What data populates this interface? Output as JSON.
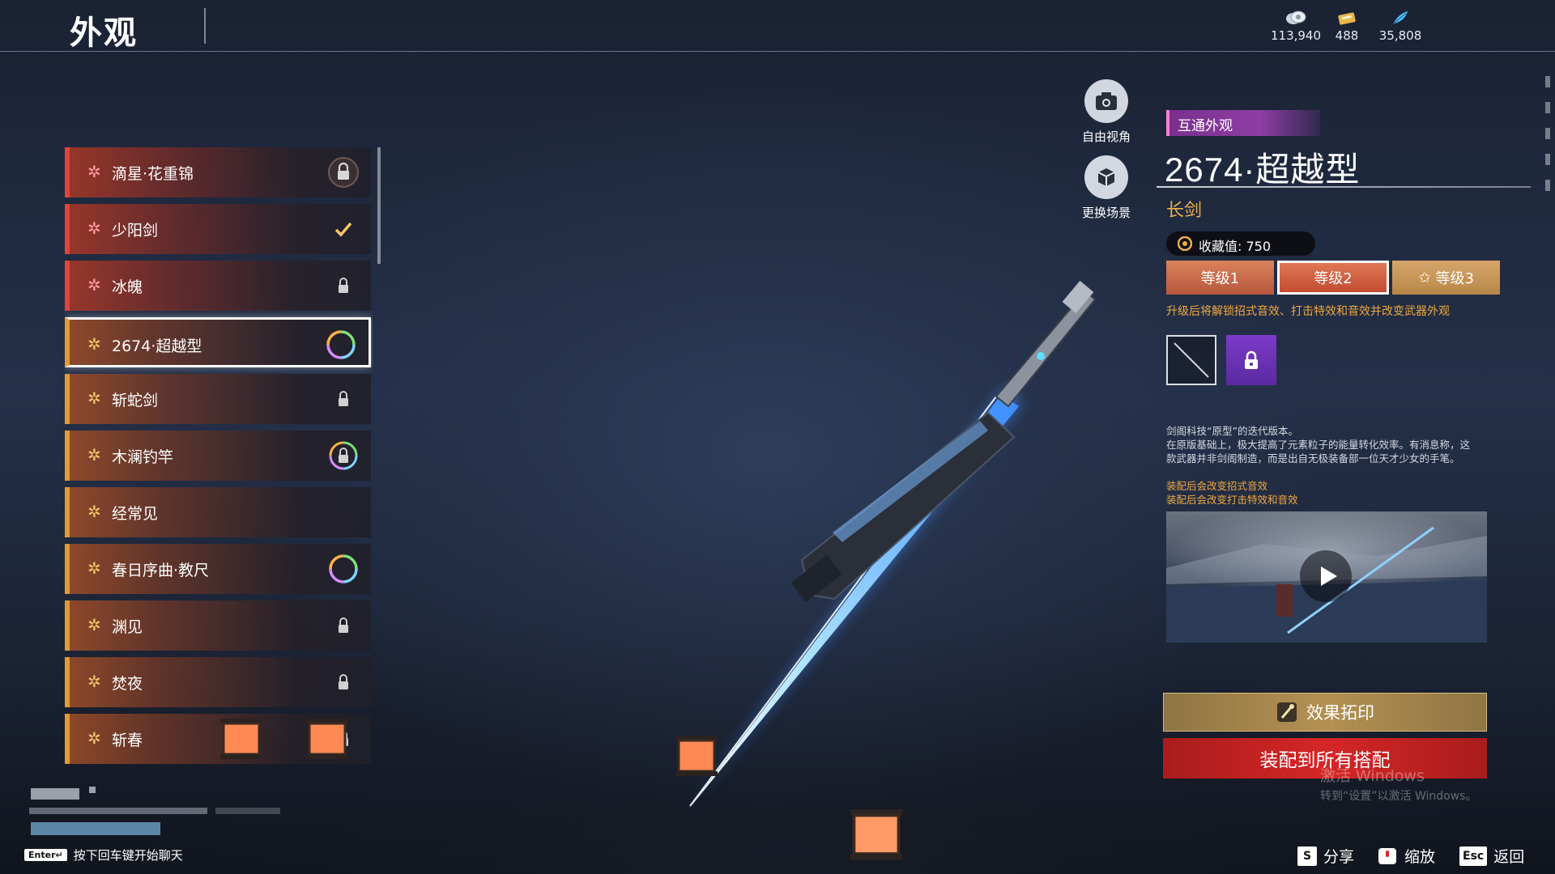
{
  "header": {
    "title": "外观",
    "currencies": [
      {
        "icon": "silver-coin-icon",
        "value": "113,940"
      },
      {
        "icon": "gold-ticket-icon",
        "value": "488"
      },
      {
        "icon": "blue-feather-icon",
        "value": "35,808"
      }
    ]
  },
  "list": {
    "items": [
      {
        "name": "滴星·花重锦",
        "rank": "pink",
        "status": "locked-badge"
      },
      {
        "name": "少阳剑",
        "rank": "pink",
        "status": "equipped"
      },
      {
        "name": "冰魄",
        "rank": "pink",
        "status": "locked"
      },
      {
        "name": "2674·超越型",
        "rank": "gold",
        "status": "rainbow-ring",
        "selected": true
      },
      {
        "name": "斩蛇剑",
        "rank": "gold",
        "status": "locked"
      },
      {
        "name": "木澜钓竿",
        "rank": "gold",
        "status": "rainbow-lock"
      },
      {
        "name": "经常见",
        "rank": "gold",
        "status": "none"
      },
      {
        "name": "春日序曲·教尺",
        "rank": "gold",
        "status": "rainbow-ring"
      },
      {
        "name": "渊见",
        "rank": "gold",
        "status": "locked"
      },
      {
        "name": "焚夜",
        "rank": "gold",
        "status": "locked"
      },
      {
        "name": "斩春",
        "rank": "gold",
        "status": "locked"
      }
    ]
  },
  "camera": {
    "free_view": "自由视角",
    "change_scene": "更换场景"
  },
  "detail": {
    "tag": "互通外观",
    "name": "2674·超越型",
    "type": "长剑",
    "collection": "收藏值: 750",
    "tiers": [
      "等级1",
      "等级2",
      "等级3"
    ],
    "active_tier": "等级2",
    "upgrade_hint": "升级后将解锁招式音效、打击特效和音效并改变武器外观",
    "desc_line1": "剑阁科技“原型”的迭代版本。",
    "desc_line2": "在原版基础上，极大提高了元素粒子的能量转化效率。有消息称，这",
    "desc_line3": "款武器并非剑阁制造，而是出自无极装备部一位天才少女的手笔。",
    "effect1": "装配后会改变招式音效",
    "effect2": "装配后会改变打击特效和音效",
    "imprint_button": "效果拓印",
    "equip_button": "装配到所有搭配"
  },
  "watermark": {
    "line1": "激活 Windows",
    "line2": "转到“设置”以激活 Windows。"
  },
  "footer": {
    "chat_key": "Enter↵",
    "chat_hint": "按下回车键开始聊天",
    "share_key": "S",
    "share": "分享",
    "zoom": "缩放",
    "back_key": "Esc",
    "back": "返回"
  },
  "colors": {
    "accent_red": "#d52626",
    "accent_gold": "#f0b047",
    "rank_pink": "#ff9aa3",
    "tag_purple": "#8e3ea3"
  }
}
